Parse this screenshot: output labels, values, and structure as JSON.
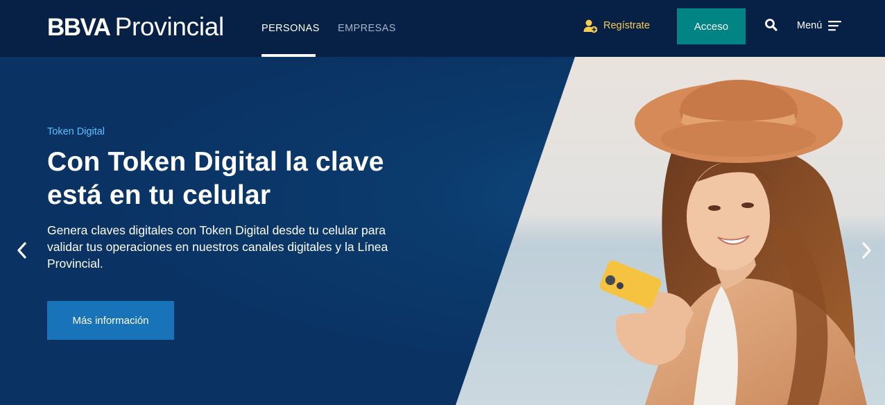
{
  "header": {
    "logo_bold": "BBVA",
    "logo_regular": "Provincial",
    "tabs": [
      {
        "label": "PERSONAS",
        "active": true
      },
      {
        "label": "EMPRESAS",
        "active": false
      }
    ],
    "register_label": "Regístrate",
    "access_label": "Acceso",
    "menu_label": "Menú"
  },
  "hero": {
    "eyebrow": "Token Digital",
    "headline": "Con Token Digital la clave está en tu celular",
    "description": "Genera claves digitales con Token Digital desde tu celular para validar tus operaciones en nuestros canales digitales y la Línea Provincial.",
    "cta_label": "Más información"
  },
  "colors": {
    "navy": "#072146",
    "hero_blue": "#0a3364",
    "teal": "#028484",
    "yellow": "#f8cd51",
    "light_blue": "#5bbeff",
    "cta_blue": "#1973b8"
  },
  "icons": [
    "add-user-icon",
    "search-icon",
    "menu-icon",
    "chevron-left-icon",
    "chevron-right-icon"
  ]
}
